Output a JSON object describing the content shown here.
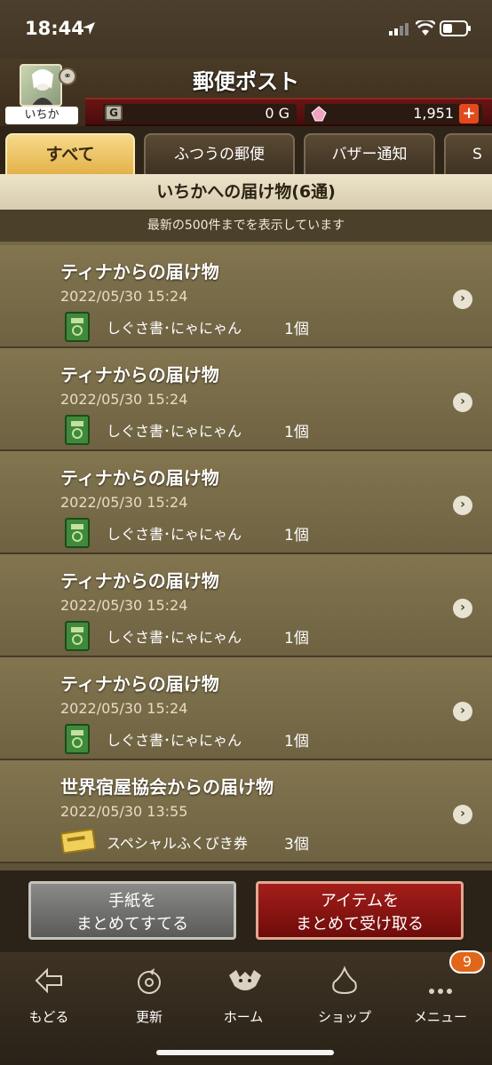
{
  "status": {
    "time": "18:44"
  },
  "header": {
    "title": "郵便ポスト",
    "user_name": "いちか",
    "gold": "0 G",
    "gold_icon": "G",
    "gems": "1,951"
  },
  "tabs": [
    {
      "label": "すべて",
      "active": true
    },
    {
      "label": "ふつうの郵便",
      "active": false
    },
    {
      "label": "バザー通知",
      "active": false
    },
    {
      "label": "S",
      "active": false
    }
  ],
  "section": {
    "title": "いちかへの届け物(6通)",
    "notice": "最新の500件までを表示しています"
  },
  "items": [
    {
      "title": "ティナからの届け物",
      "date": "2022/05/30  15:24",
      "item": "しぐさ書･にゃにゃん",
      "qty": "1個",
      "icon": "green-book-icon"
    },
    {
      "title": "ティナからの届け物",
      "date": "2022/05/30  15:24",
      "item": "しぐさ書･にゃにゃん",
      "qty": "1個",
      "icon": "green-book-icon"
    },
    {
      "title": "ティナからの届け物",
      "date": "2022/05/30  15:24",
      "item": "しぐさ書･にゃにゃん",
      "qty": "1個",
      "icon": "green-book-icon"
    },
    {
      "title": "ティナからの届け物",
      "date": "2022/05/30  15:24",
      "item": "しぐさ書･にゃにゃん",
      "qty": "1個",
      "icon": "green-book-icon"
    },
    {
      "title": "ティナからの届け物",
      "date": "2022/05/30  15:24",
      "item": "しぐさ書･にゃにゃん",
      "qty": "1個",
      "icon": "green-book-icon"
    },
    {
      "title": "世界宿屋協会からの届け物",
      "date": "2022/05/30  13:55",
      "item": "スペシャルふくびき券",
      "qty": "3個",
      "icon": "ticket-icon"
    }
  ],
  "buttons": {
    "discard_line1": "手紙を",
    "discard_line2": "まとめてすてる",
    "receive_line1": "アイテムを",
    "receive_line2": "まとめて受け取る"
  },
  "nav": [
    {
      "label": "もどる",
      "icon": "back-arrow-icon"
    },
    {
      "label": "更新",
      "icon": "refresh-icon"
    },
    {
      "label": "ホーム",
      "icon": "home-dracky-icon"
    },
    {
      "label": "ショップ",
      "icon": "slime-shop-icon"
    },
    {
      "label": "メニュー",
      "icon": "menu-dots-icon"
    }
  ],
  "menu_badge": "9"
}
